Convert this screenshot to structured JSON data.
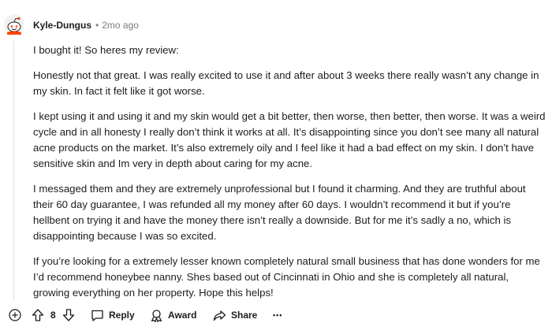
{
  "comment": {
    "author": "Kyle-Dungus",
    "separator": "•",
    "time_ago": "2mo ago",
    "paragraphs": [
      "I bought it! So heres my review:",
      "Honestly not that great. I was really excited to use it and after about 3 weeks there really wasn’t any change in my skin. In fact it felt like it got worse.",
      "I kept using it and using it and my skin would get a bit better, then worse, then better, then worse. It was a weird cycle and in all honesty I really don’t think it works at all. It’s disappointing since you don’t see many all natural acne products on the market. It’s also extremely oily and I feel like it had a bad effect on my skin. I don’t have sensitive skin and Im very in depth about caring for my acne.",
      "I messaged them and they are extremely unprofessional but I found it charming. And they are truthful about their 60 day guarantee, I was refunded all my money after 60 days. I wouldn’t recommend it but if you’re hellbent on trying it and have the money there isn’t really a downside. But for me it’s sadly a no, which is disappointing because I was so excited.",
      "If you’re looking for a extremely lesser known completely natural small business that has done wonders for me I’d recommend honeybee nanny. Shes based out of Cincinnati in Ohio and she is completely all natural, growing everything on her property. Hope this helps!"
    ]
  },
  "actions": {
    "vote_count": "8",
    "reply_label": "Reply",
    "award_label": "Award",
    "share_label": "Share",
    "more_label": "•••"
  },
  "colors": {
    "avatar_accent": "#ff4500",
    "meta_text": "#7c7c7c",
    "thread_line": "#e0e0e0"
  },
  "icons": [
    "reddit-snoo-avatar",
    "expand-plus-icon",
    "upvote-icon",
    "downvote-icon",
    "comment-bubble-icon",
    "award-icon",
    "share-icon",
    "more-options-icon"
  ]
}
